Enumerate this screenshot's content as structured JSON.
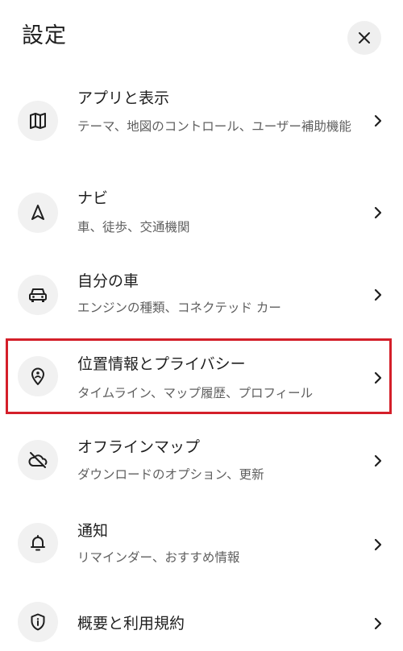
{
  "header": {
    "title": "設定"
  },
  "close_icon": "close-icon",
  "items": [
    {
      "key": "display",
      "icon": "map-icon",
      "title": "アプリと表示",
      "subtitle": "テーマ、地図のコントロール、ユーザー補助機能"
    },
    {
      "key": "navigation",
      "icon": "navigation-arrow-icon",
      "title": "ナビ",
      "subtitle": "車、徒歩、交通機関"
    },
    {
      "key": "vehicle",
      "icon": "car-icon",
      "title": "自分の車",
      "subtitle": "エンジンの種類、コネクテッド カー"
    },
    {
      "key": "location-privacy",
      "icon": "location-pin-person-icon",
      "title": "位置情報とプライバシー",
      "subtitle": "タイムライン、マップ履歴、プロフィール",
      "highlighted": true
    },
    {
      "key": "offline-maps",
      "icon": "cloud-off-icon",
      "title": "オフラインマップ",
      "subtitle": "ダウンロードのオプション、更新"
    },
    {
      "key": "notifications",
      "icon": "bell-icon",
      "title": "通知",
      "subtitle": "リマインダー、おすすめ情報"
    },
    {
      "key": "about",
      "icon": "shield-info-icon",
      "title": "概要と利用規約",
      "subtitle": ""
    }
  ],
  "highlight_color": "#d41f2a"
}
